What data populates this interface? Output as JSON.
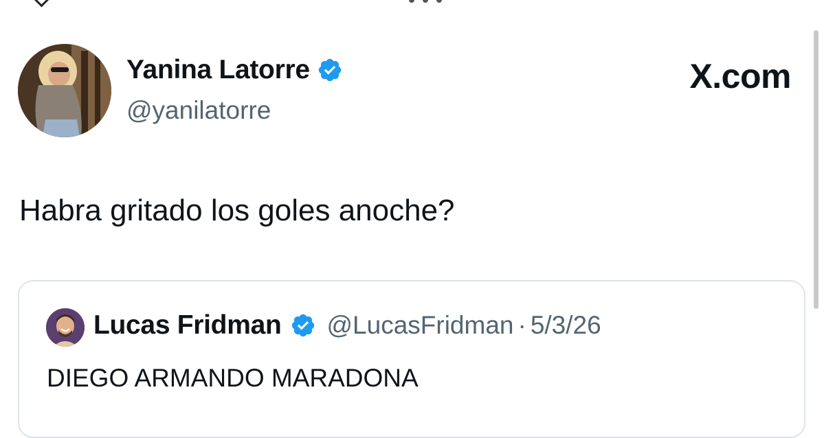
{
  "tweet": {
    "author_name": "Yanina Latorre",
    "author_handle": "@yanilatorre",
    "brand": "X.com",
    "text": "Habra gritado los goles anoche?"
  },
  "quoted_tweet": {
    "author_name": "Lucas Fridman",
    "author_handle": "@LucasFridman",
    "separator": "·",
    "date": "5/3/26",
    "text": "DIEGO ARMANDO MARADONA"
  },
  "icons": {
    "verified": "verified-badge-icon",
    "brand_logo": "x-logo-icon"
  },
  "colors": {
    "verified_blue": "#1d9bf0",
    "text_primary": "#0f1419",
    "text_secondary": "#536471",
    "card_border": "#dde3e8"
  }
}
